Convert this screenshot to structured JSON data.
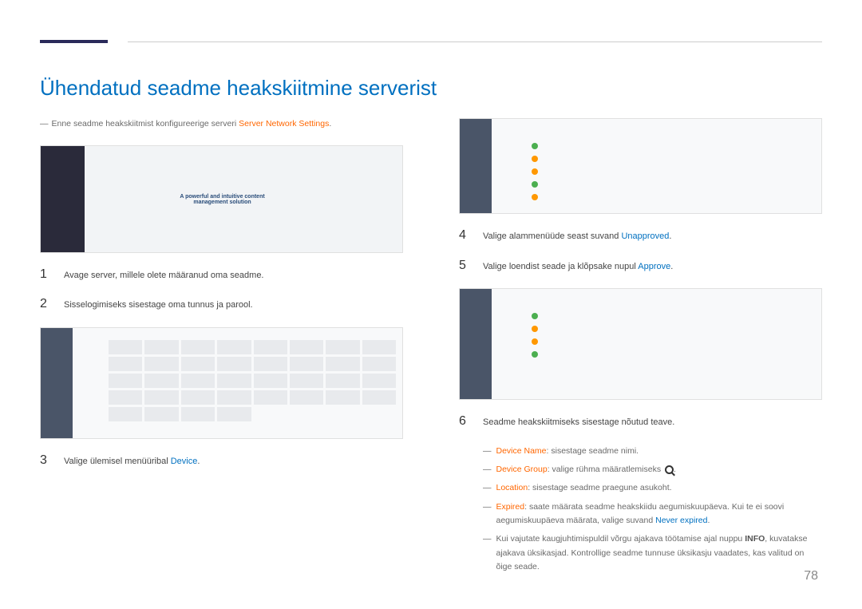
{
  "title": "Ühendatud seadme heakskiitmine serverist",
  "intro": {
    "dash": "―",
    "text_before": "Enne seadme heakskiitmist konfigureerige serveri ",
    "link": "Server Network Settings",
    "dot": "."
  },
  "screenshot1": {
    "tagline_1": "A powerful and intuitive content",
    "tagline_2": "management solution"
  },
  "steps": {
    "s1": {
      "num": "1",
      "text": "Avage server, millele olete määranud oma seadme."
    },
    "s2": {
      "num": "2",
      "text": "Sisselogimiseks sisestage oma tunnus ja parool."
    },
    "s3": {
      "num": "3",
      "text_before": "Valige ülemisel menüüribal ",
      "link": "Device",
      "dot": "."
    },
    "s4": {
      "num": "4",
      "text_before": "Valige alammenüüde seast suvand ",
      "link": "Unapproved",
      "dot": "."
    },
    "s5": {
      "num": "5",
      "text_before": "Valige loendist seade ja klõpsake nupul ",
      "link": "Approve",
      "dot": "."
    },
    "s6": {
      "num": "6",
      "text": "Seadme heakskiitmiseks sisestage nõutud teave."
    }
  },
  "sublist": {
    "dash": "―",
    "i1": {
      "label": "Device Name",
      "text": ": sisestage seadme nimi."
    },
    "i2": {
      "label": "Device Group",
      "text": ": valige rühma määratlemiseks "
    },
    "i3": {
      "label": "Location",
      "text": ": sisestage seadme praegune asukoht."
    },
    "i4": {
      "label": "Expired",
      "text_a": ": saate määrata seadme heakskiidu aegumiskuupäeva. Kui te ei soovi aegumiskuupäeva määrata, valige suvand ",
      "link": "Never expired",
      "dot": "."
    },
    "i5": {
      "text_a": "Kui vajutate kaugjuhtimispuldil võrgu ajakava töötamise ajal nuppu ",
      "bold": "INFO",
      "text_b": ", kuvatakse ajakava üksikasjad. Kontrollige seadme tunnuse üksikasju vaadates, kas valitud on õige seade."
    }
  },
  "page_number": "78"
}
